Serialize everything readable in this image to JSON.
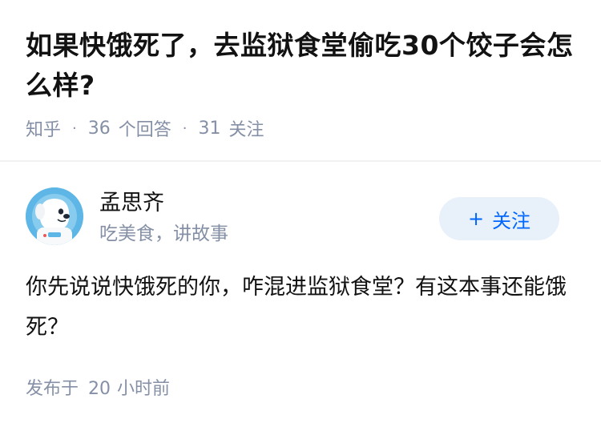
{
  "question": {
    "title": "如果快饿死了，去监狱食堂偷吃30个饺子会怎么样?"
  },
  "meta": {
    "source": "知乎",
    "answer_count": "36",
    "answer_label": "个回答",
    "follower_count": "31",
    "follower_label": "关注",
    "separator": "·"
  },
  "author": {
    "name": "孟思齐",
    "bio": "吃美食，讲故事",
    "avatar_icon": "cartoon-dog-astronaut-avatar",
    "follow_icon": "plus-icon",
    "follow_plus": "+",
    "follow_label": "关注"
  },
  "answer": {
    "content": "你先说说快饿死的你，咋混进监狱食堂？有这本事还能饿死？"
  },
  "footer": {
    "published_prefix": "发布于",
    "published_num": "20",
    "published_suffix": "小时前"
  },
  "colors": {
    "accent": "#0066ff",
    "follow_bg": "#e8f1fa",
    "meta_text": "#8590a6",
    "main_text": "#121212"
  }
}
